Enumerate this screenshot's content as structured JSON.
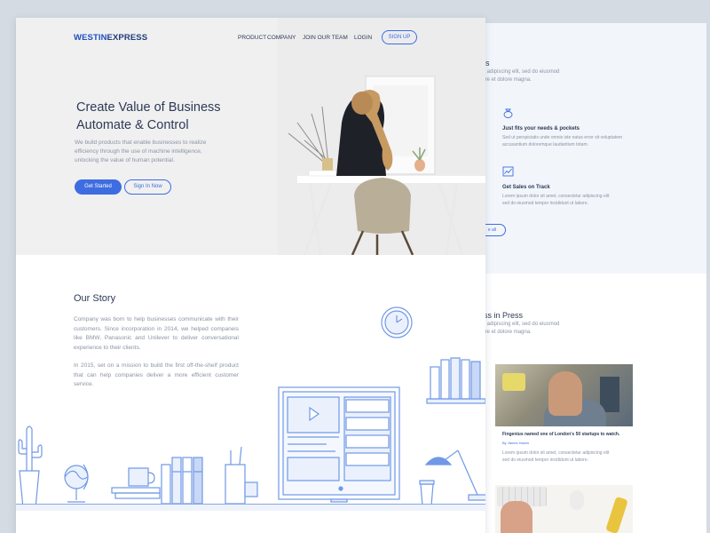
{
  "colors": {
    "accent": "#3d6de0",
    "title_text": "#2d3a55",
    "body_text": "#8b93a3",
    "illustration_line": "#7098e6",
    "background": "#d5dbe3"
  },
  "header": {
    "logo_part1": "WESTIN",
    "logo_part2": "EXPRESS",
    "nav": [
      {
        "label": "PRODUCT"
      },
      {
        "label": "COMPANY"
      },
      {
        "label": "JOIN OUR TEAM"
      },
      {
        "label": "LOGIN"
      }
    ],
    "signup_label": "SIGN UP"
  },
  "hero": {
    "title_line1": "Create Value of Business",
    "title_line2": "Automate & Control",
    "description": "We build products that enable businesses to realize efficiency through the use of machine intelligence, unlocking the value of human potential.",
    "primary_button": "Get Started",
    "secondary_button": "Sign In Now"
  },
  "story": {
    "title": "Our Story",
    "paragraph1": "Company  was born to help businesses communicate with their customers. Since incorporation in 2014, we helped companeis like BMW, Panasonic and Unilever to deliver conversational experience to their clients.",
    "paragraph2": "In 2015,  set on a mission to build the first off-the-shelf product that can help companies deliver a more efficient customer service."
  },
  "back_page": {
    "benefits_title": "fits",
    "benefits_desc_line1": "tur adipiscing elit, sed do eiusmod",
    "benefits_desc_line2": "bore et dolore magna.",
    "features": [
      {
        "icon": "moneybag-icon",
        "title": "Just fits your needs & pockets",
        "desc_line1": "Sed ut perspiciatis unde omnis iste natus error sit voluptatem",
        "desc_line2": "accusantium doloremque laudantium totam."
      },
      {
        "icon": "chart-icon",
        "title": "Get Sales on Track",
        "desc_line1": "Lorem ipsum dolor sit amet, consectetur adipiscing elit",
        "desc_line2": "sed do eiusmod tempor incididunt ut labore."
      }
    ],
    "view_all_label": "e all",
    "press_title": "ess in Press",
    "press_desc_line1": "tur adipiscing elit, sed do eiusmod",
    "press_desc_line2": "bore et dolore magna.",
    "press_item": {
      "caption": "Fingenius named one of London's 50 startups to watch.",
      "byline": "By James Hazen",
      "text_line1": "Lorem ipsum dolor sit amet, consectetur adipiscing elit",
      "text_line2": "sed do eiusmod tempor incididunt ut labore."
    }
  }
}
